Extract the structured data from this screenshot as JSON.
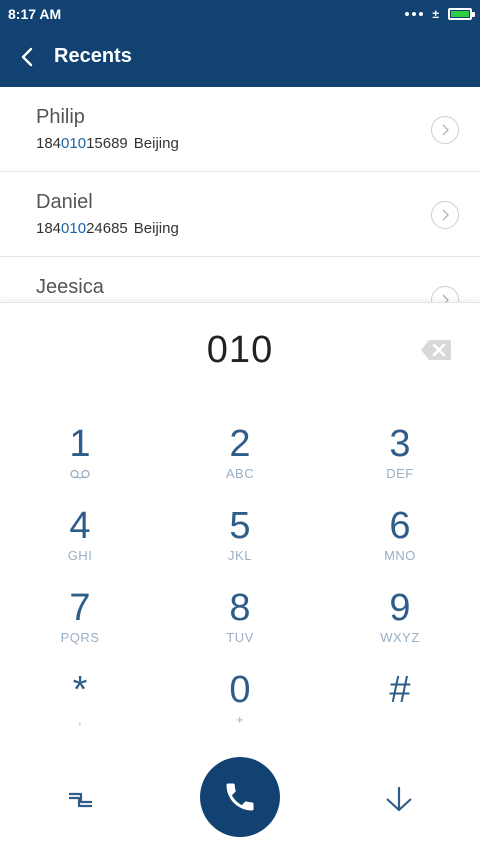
{
  "status_bar": {
    "time": "8:17 AM",
    "sync_glyph": "±"
  },
  "header": {
    "title": "Recents",
    "back_icon": "chevron-left-icon",
    "background": "#124271"
  },
  "recents": [
    {
      "name": "Philip",
      "number_prefix": "184",
      "number_match": "010",
      "number_suffix": "15689",
      "location": "Beijing"
    },
    {
      "name": "Daniel",
      "number_prefix": "184",
      "number_match": "010",
      "number_suffix": "24685",
      "location": "Beijing"
    },
    {
      "name": "Jeesica"
    }
  ],
  "dialpad": {
    "input_value": "010",
    "keys": [
      {
        "digit": "1",
        "letters": "",
        "icon": "voicemail-icon"
      },
      {
        "digit": "2",
        "letters": "ABC"
      },
      {
        "digit": "3",
        "letters": "DEF"
      },
      {
        "digit": "4",
        "letters": "GHI"
      },
      {
        "digit": "5",
        "letters": "JKL"
      },
      {
        "digit": "6",
        "letters": "MNO"
      },
      {
        "digit": "7",
        "letters": "PQRS"
      },
      {
        "digit": "8",
        "letters": "TUV"
      },
      {
        "digit": "9",
        "letters": "WXYZ"
      },
      {
        "digit": "*",
        "letters": ","
      },
      {
        "digit": "0",
        "letters": "+"
      },
      {
        "digit": "#",
        "letters": ""
      }
    ]
  },
  "colors": {
    "accent": "#124271",
    "key_digit": "#2e5d8a",
    "key_letters": "#9ab0c4",
    "match_highlight": "#1a63a8"
  }
}
